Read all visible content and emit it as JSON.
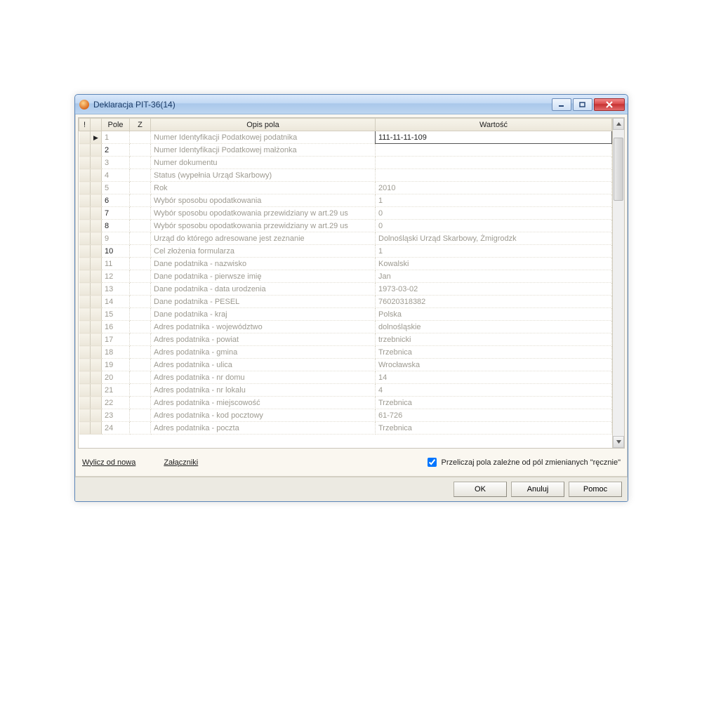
{
  "window": {
    "title": "Deklaracja PIT-36(14)"
  },
  "columns": {
    "mark": "!",
    "pole": "Pole",
    "z": "Z",
    "opis": "Opis pola",
    "wartosc": "Wartość"
  },
  "rows": [
    {
      "pole": "1",
      "dark": false,
      "selected": true,
      "opis": "Numer Identyfikacji Podatkowej podatnika",
      "wartosc": "111-11-11-109"
    },
    {
      "pole": "2",
      "dark": true,
      "opis": "Numer Identyfikacji Podatkowej małżonka",
      "wartosc": ""
    },
    {
      "pole": "3",
      "dark": false,
      "opis": "Numer dokumentu",
      "wartosc": ""
    },
    {
      "pole": "4",
      "dark": false,
      "opis": "Status (wypełnia Urząd Skarbowy)",
      "wartosc": ""
    },
    {
      "pole": "5",
      "dark": false,
      "opis": "Rok",
      "wartosc": "2010"
    },
    {
      "pole": "6",
      "dark": true,
      "opis": "Wybór sposobu opodatkowania",
      "wartosc": "1"
    },
    {
      "pole": "7",
      "dark": true,
      "opis": "Wybór sposobu opodatkowania przewidziany w art.29 us",
      "wartosc": "0"
    },
    {
      "pole": "8",
      "dark": true,
      "opis": "Wybór sposobu opodatkowania przewidziany w art.29 us",
      "wartosc": "0"
    },
    {
      "pole": "9",
      "dark": false,
      "opis": "Urząd do którego adresowane jest zeznanie",
      "wartosc": "Dolnośląski Urząd Skarbowy, Żmigrodzk"
    },
    {
      "pole": "10",
      "dark": true,
      "opis": "Cel złożenia formularza",
      "wartosc": "1"
    },
    {
      "pole": "11",
      "dark": false,
      "opis": "Dane podatnika - nazwisko",
      "wartosc": "Kowalski"
    },
    {
      "pole": "12",
      "dark": false,
      "opis": "Dane podatnika - pierwsze imię",
      "wartosc": "Jan"
    },
    {
      "pole": "13",
      "dark": false,
      "opis": "Dane podatnika - data urodzenia",
      "wartosc": "1973-03-02"
    },
    {
      "pole": "14",
      "dark": false,
      "opis": "Dane podatnika - PESEL",
      "wartosc": "76020318382"
    },
    {
      "pole": "15",
      "dark": false,
      "opis": "Dane podatnika - kraj",
      "wartosc": "Polska"
    },
    {
      "pole": "16",
      "dark": false,
      "opis": "Adres podatnika - województwo",
      "wartosc": "dolnośląskie"
    },
    {
      "pole": "17",
      "dark": false,
      "opis": "Adres podatnika - powiat",
      "wartosc": "trzebnicki"
    },
    {
      "pole": "18",
      "dark": false,
      "opis": "Adres podatnika - gmina",
      "wartosc": "Trzebnica"
    },
    {
      "pole": "19",
      "dark": false,
      "opis": "Adres podatnika - ulica",
      "wartosc": "Wrocławska"
    },
    {
      "pole": "20",
      "dark": false,
      "opis": "Adres podatnika - nr domu",
      "wartosc": "14"
    },
    {
      "pole": "21",
      "dark": false,
      "opis": "Adres podatnika - nr lokalu",
      "wartosc": "4"
    },
    {
      "pole": "22",
      "dark": false,
      "opis": "Adres podatnika - miejscowość",
      "wartosc": "Trzebnica"
    },
    {
      "pole": "23",
      "dark": false,
      "opis": "Adres podatnika - kod pocztowy",
      "wartosc": "61-726"
    },
    {
      "pole": "24",
      "dark": false,
      "opis": "Adres podatnika - poczta",
      "wartosc": "Trzebnica"
    }
  ],
  "links": {
    "wylicz": "Wylicz od nowa",
    "zalaczniki": "Załączniki"
  },
  "checkbox": {
    "label": "Przeliczaj pola zależne od pól zmienianych \"ręcznie\"",
    "checked": true
  },
  "buttons": {
    "ok": "OK",
    "anuluj": "Anuluj",
    "pomoc": "Pomoc"
  }
}
